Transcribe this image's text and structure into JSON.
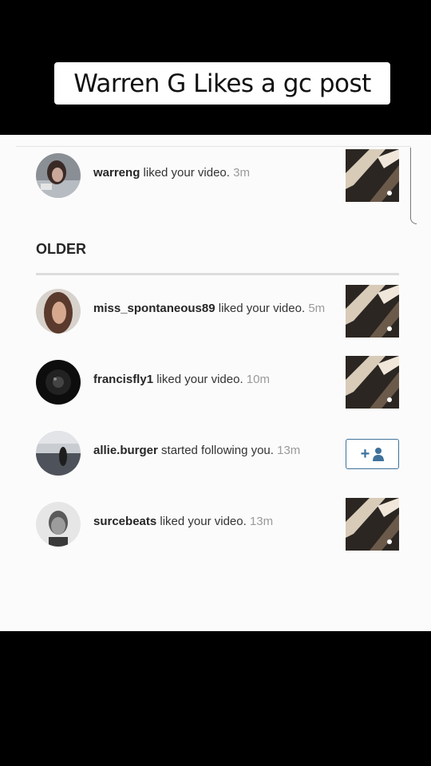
{
  "caption": "Warren G Likes a gc post",
  "section_title": "OLDER",
  "recent": [
    {
      "username": "warreng",
      "action": "liked your video.",
      "time": "3m",
      "right": "thumbnail"
    }
  ],
  "older": [
    {
      "username": "miss_spontaneous89",
      "action": "liked your video.",
      "time": "5m",
      "right": "thumbnail"
    },
    {
      "username": "francisfly1",
      "action": "liked your video.",
      "time": "10m",
      "right": "thumbnail"
    },
    {
      "username": "allie.burger",
      "action": "started following you.",
      "time": "13m",
      "right": "follow-button"
    },
    {
      "username": "surcebeats",
      "action": "liked your video.",
      "time": "13m",
      "right": "thumbnail"
    }
  ],
  "follow_button": {
    "plus": "+",
    "icon": "person-icon",
    "accent": "#3f729b"
  }
}
